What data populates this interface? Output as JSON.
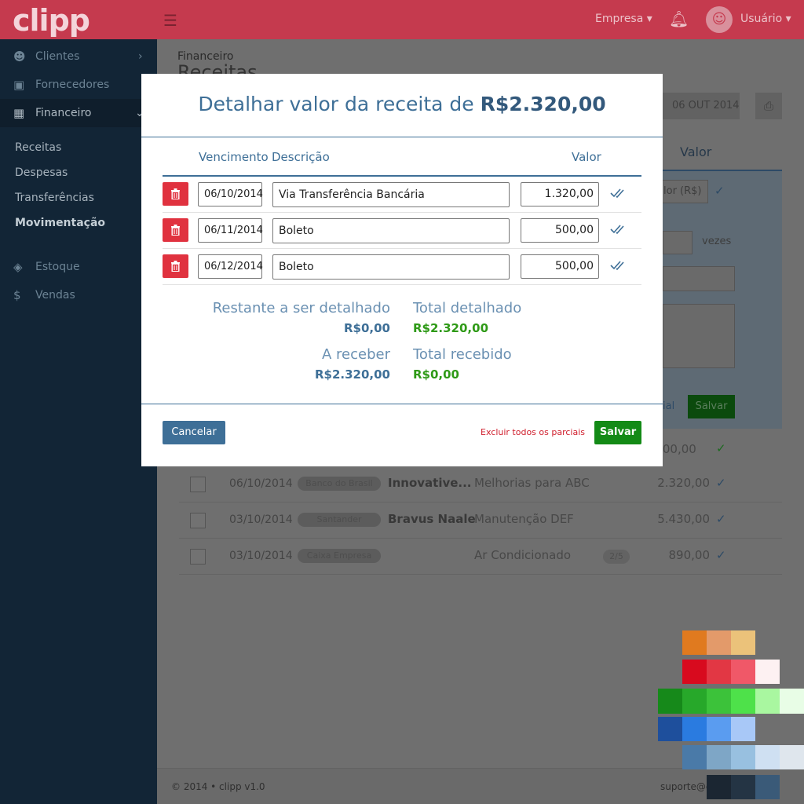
{
  "app": {
    "logo": "clipp"
  },
  "topbar": {
    "empresa_label": "Empresa",
    "user_label": "Usuário"
  },
  "sidebar": {
    "items": [
      {
        "label": "Clientes"
      },
      {
        "label": "Fornecedores"
      },
      {
        "label": "Financeiro"
      },
      {
        "label": "Estoque"
      },
      {
        "label": "Vendas"
      }
    ],
    "sub_items": [
      {
        "label": "Receitas"
      },
      {
        "label": "Despesas"
      },
      {
        "label": "Transferências"
      },
      {
        "label": "Movimentação"
      }
    ]
  },
  "page": {
    "breadcrumb": "Financeiro",
    "title": "Receitas",
    "date_button": "06 OUT 2014"
  },
  "background_form": {
    "valor_header": "Valor",
    "valor_placeholder": "lor (R$)",
    "vezes_label": "vezes",
    "salvar_label": "Salvar",
    "partial_label": "ial"
  },
  "background_list": {
    "first_value": "7.000,00",
    "rows": [
      {
        "date": "06/10/2014",
        "bank": "Banco do Brasil",
        "name": "Innovative...",
        "desc": "Melhorias para ABC",
        "pill": "",
        "value": "2.320,00"
      },
      {
        "date": "03/10/2014",
        "bank": "Santander",
        "name": "Bravus Naale",
        "desc": "Manutenção DEF",
        "pill": "",
        "value": "5.430,00"
      },
      {
        "date": "03/10/2014",
        "bank": "Caixa Empresa",
        "name": "",
        "desc": "Ar Condicionado",
        "pill": "2/5",
        "value": "890,00"
      }
    ]
  },
  "footer": {
    "left": "© 2014  •  clipp v1.0",
    "right": "suporte@c"
  },
  "modal": {
    "title_prefix": "Detalhar valor da receita de ",
    "title_amount": "R$2.320,00",
    "columns": {
      "vencimento": "Vencimento",
      "descricao": "Descrição",
      "valor": "Valor"
    },
    "rows": [
      {
        "date": "06/10/2014",
        "description": "Via Transferência Bancária",
        "value": "1.320,00"
      },
      {
        "date": "06/11/2014",
        "description": "Boleto",
        "value": "500,00"
      },
      {
        "date": "06/12/2014",
        "description": "Boleto",
        "value": "500,00"
      }
    ],
    "summary": {
      "restante_label": "Restante a ser detalhado",
      "restante_value": "R$0,00",
      "total_detalhado_label": "Total detalhado",
      "total_detalhado_value": "R$2.320,00",
      "a_receber_label": "A receber",
      "a_receber_value": "R$2.320,00",
      "total_recebido_label": "Total recebido",
      "total_recebido_value": "R$0,00"
    },
    "cancel_label": "Cancelar",
    "excluir_label": "Excluir todos os parciais",
    "save_label": "Salvar"
  },
  "colors": {
    "accent_blue": "#3e6f97",
    "success_green": "#138a16",
    "danger_red": "#e0323f",
    "brand_red": "#c53a4e",
    "sidebar_dark": "#122536"
  },
  "swatches": [
    "#e07a1f",
    "#e39a6a",
    "#ebc27a",
    "#d80a1e",
    "#e23744",
    "#f05868",
    "#fdf1f2",
    "#16891a",
    "#27a82a",
    "#3cc23a",
    "#4ee14a",
    "#a9f7a0",
    "#e8fde6",
    "#1e4f9c",
    "#2a7be0",
    "#5a9cf0",
    "#a8c8f7",
    "#4a7aa8",
    "#7ea6c6",
    "#98c0e0",
    "#cfe0f2",
    "#dfe6ed",
    "#1b2632",
    "#243444",
    "#3a5a78"
  ]
}
